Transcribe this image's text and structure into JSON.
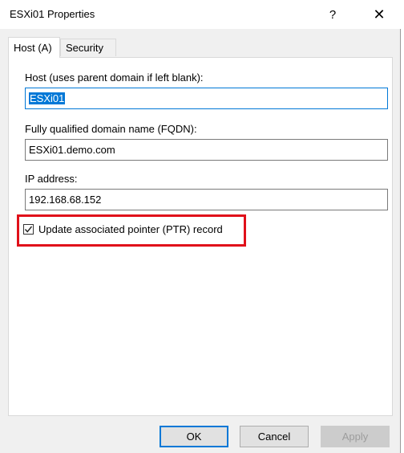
{
  "window": {
    "title": "ESXi01 Properties",
    "help_label": "?",
    "close_label": "✕"
  },
  "tabs": [
    {
      "label": "Host (A)",
      "active": true
    },
    {
      "label": "Security",
      "active": false
    }
  ],
  "host_field": {
    "label": "Host (uses parent domain if left blank):",
    "value": "ESXi01"
  },
  "fqdn_field": {
    "label": "Fully qualified domain name (FQDN):",
    "value": "ESXi01.demo.com"
  },
  "ip_field": {
    "label": "IP address:",
    "value": "192.168.68.152"
  },
  "ptr_checkbox": {
    "label": "Update associated pointer (PTR) record",
    "checked": true
  },
  "buttons": {
    "ok": "OK",
    "cancel": "Cancel",
    "apply": "Apply"
  },
  "colors": {
    "highlight": "#e0101a",
    "accent": "#0078d7"
  }
}
